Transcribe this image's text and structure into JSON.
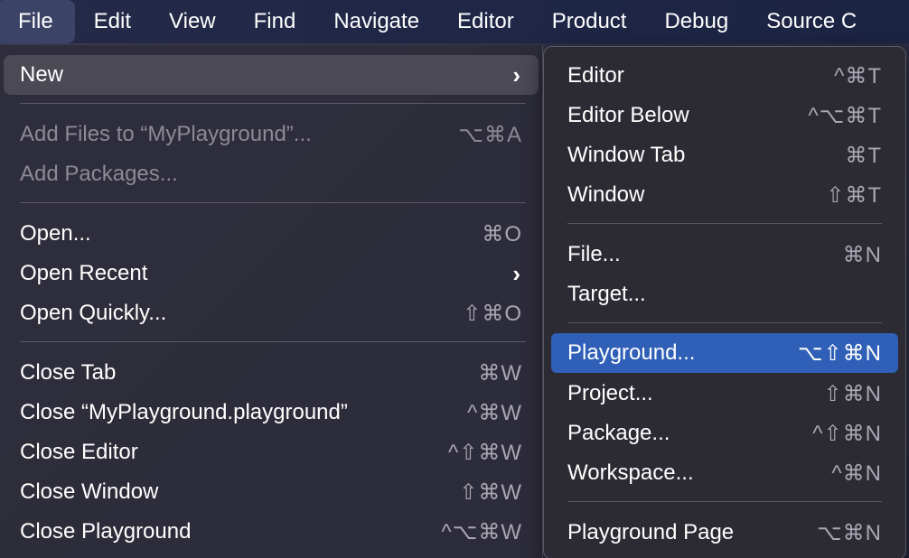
{
  "menubar": {
    "items": [
      {
        "label": "File",
        "active": true
      },
      {
        "label": "Edit"
      },
      {
        "label": "View"
      },
      {
        "label": "Find"
      },
      {
        "label": "Navigate"
      },
      {
        "label": "Editor"
      },
      {
        "label": "Product"
      },
      {
        "label": "Debug"
      },
      {
        "label": "Source C"
      }
    ]
  },
  "file_menu": {
    "new": {
      "label": "New"
    },
    "add_files": {
      "label": "Add Files to “MyPlayground”...",
      "shortcut": "⌥⌘A"
    },
    "add_packages": {
      "label": "Add Packages..."
    },
    "open": {
      "label": "Open...",
      "shortcut": "⌘O"
    },
    "open_recent": {
      "label": "Open Recent"
    },
    "open_quickly": {
      "label": "Open Quickly...",
      "shortcut": "⇧⌘O"
    },
    "close_tab": {
      "label": "Close Tab",
      "shortcut": "⌘W"
    },
    "close_playground_file": {
      "label": "Close “MyPlayground.playground”",
      "shortcut": "^⌘W"
    },
    "close_editor": {
      "label": "Close Editor",
      "shortcut": "^⇧⌘W"
    },
    "close_window": {
      "label": "Close Window",
      "shortcut": "⇧⌘W"
    },
    "close_playground": {
      "label": "Close Playground",
      "shortcut": "^⌥⌘W"
    }
  },
  "new_submenu": {
    "editor": {
      "label": "Editor",
      "shortcut": "^⌘T"
    },
    "editor_below": {
      "label": "Editor Below",
      "shortcut": "^⌥⌘T"
    },
    "window_tab": {
      "label": "Window Tab",
      "shortcut": "⌘T"
    },
    "window": {
      "label": "Window",
      "shortcut": "⇧⌘T"
    },
    "file": {
      "label": "File...",
      "shortcut": "⌘N"
    },
    "target": {
      "label": "Target..."
    },
    "playground": {
      "label": "Playground...",
      "shortcut": "⌥⇧⌘N"
    },
    "project": {
      "label": "Project...",
      "shortcut": "⇧⌘N"
    },
    "package": {
      "label": "Package...",
      "shortcut": "^⇧⌘N"
    },
    "workspace": {
      "label": "Workspace...",
      "shortcut": "^⌘N"
    },
    "playground_page": {
      "label": "Playground Page",
      "shortcut": "⌥⌘N"
    }
  },
  "colors": {
    "selection": "#2f5fb6",
    "menu_bg": "#2c2b34",
    "menubar_bg": "#1f2646"
  }
}
